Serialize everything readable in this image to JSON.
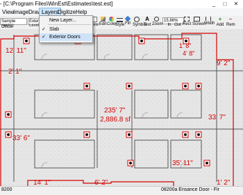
{
  "window": {
    "title": "- [C:\\Program Files\\WinEst\\Estimates\\test.est]",
    "controls": [
      "_",
      "□",
      "✕"
    ]
  },
  "menubar": {
    "items": [
      "View",
      "Image",
      "Drawing",
      "Layers",
      "Digitize",
      "Help"
    ],
    "open_index": 3
  },
  "layers_menu": {
    "items": [
      {
        "label": "New Layer...",
        "checked": false
      },
      {
        "label": "Slab",
        "checked": true
      },
      {
        "label": "Exterior Doors",
        "checked": true
      }
    ],
    "highlighted_index": 2
  },
  "toolbar": {
    "left_combo": "Sample Office",
    "second_combo": "Exter",
    "sublabel_left": "rawing",
    "sublabel_mid": "Level",
    "tools": [
      "New",
      "Edit",
      "Color",
      "Style",
      "Fill",
      "Symbol",
      "Text",
      "Zoom",
      "In",
      "Out",
      "Rect",
      "Screen",
      "Width",
      "Add",
      "Rem"
    ],
    "zoom_value": "15.86%"
  },
  "drawing": {
    "labels": [
      "12' 11\"",
      "1' 8\"",
      "4' 8\"",
      "9' 2\"",
      "2' 1\"",
      "235' 7\"",
      "2,886.8 sf",
      "33' 7\"",
      "33' 6\"",
      "35' 11\"",
      "14' 1\"",
      "6' 2\"",
      "1' 2\""
    ],
    "color_dimension": "#d40000"
  },
  "statusbar": {
    "left": "8200",
    "middle": "08200a Ensance Door - Fir"
  }
}
